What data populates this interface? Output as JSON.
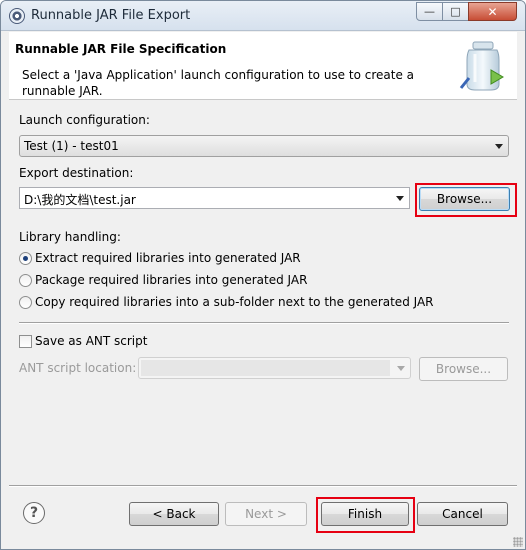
{
  "window": {
    "title": "Runnable JAR File Export",
    "minimize_glyph": "—",
    "maximize_glyph": "□",
    "close_glyph": "✕"
  },
  "banner": {
    "title": "Runnable JAR File Specification",
    "description": "Select a 'Java Application' launch configuration to use to create a runnable JAR."
  },
  "launch_config": {
    "label": "Launch configuration:",
    "selected": "Test (1) - test01"
  },
  "export_destination": {
    "label": "Export destination:",
    "value": "D:\\我的文档\\test.jar",
    "browse_label": "Browse..."
  },
  "library_handling": {
    "label": "Library handling:",
    "options": [
      {
        "label": "Extract required libraries into generated JAR",
        "checked": true
      },
      {
        "label": "Package required libraries into generated JAR",
        "checked": false
      },
      {
        "label": "Copy required libraries into a sub-folder next to the generated JAR",
        "checked": false
      }
    ]
  },
  "ant": {
    "save_label": "Save as ANT script",
    "location_label": "ANT script location:",
    "browse_label": "Browse..."
  },
  "footer": {
    "help_glyph": "?",
    "back_label": "< Back",
    "next_label": "Next >",
    "finish_label": "Finish",
    "cancel_label": "Cancel"
  },
  "colors": {
    "highlight": "#e60012",
    "selected_radio": "#1c3f7a"
  }
}
